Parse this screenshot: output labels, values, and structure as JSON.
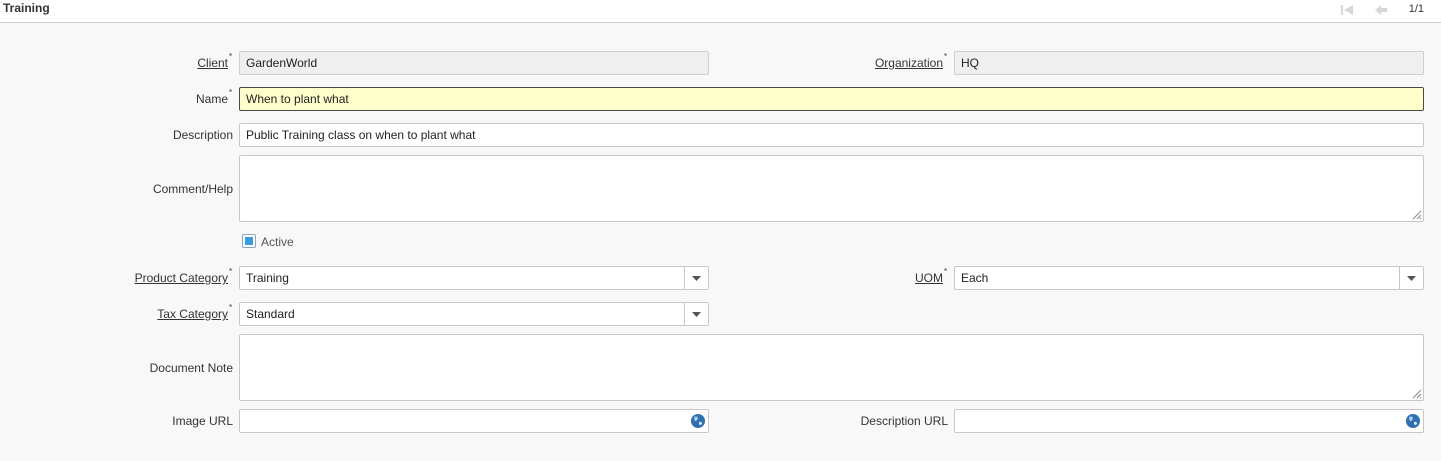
{
  "window": {
    "title": "Training",
    "pager": "1/1"
  },
  "form": {
    "client": {
      "label": "Client",
      "value": "GardenWorld",
      "required_mark": "*"
    },
    "organization": {
      "label": "Organization",
      "value": "HQ",
      "required_mark": "*"
    },
    "name": {
      "label": "Name",
      "value": "When to plant what",
      "required_mark": "*"
    },
    "description": {
      "label": "Description",
      "value": "Public Training class on when to plant what"
    },
    "comment_help": {
      "label": "Comment/Help",
      "value": ""
    },
    "active": {
      "label": "Active",
      "checked": true
    },
    "product_category": {
      "label": "Product Category",
      "value": "Training",
      "required_mark": "*"
    },
    "uom": {
      "label": "UOM",
      "value": "Each",
      "required_mark": "*"
    },
    "tax_category": {
      "label": "Tax Category",
      "value": "Standard",
      "required_mark": "*"
    },
    "document_note": {
      "label": "Document Note",
      "value": ""
    },
    "image_url": {
      "label": "Image URL",
      "value": ""
    },
    "description_url": {
      "label": "Description URL",
      "value": ""
    }
  },
  "colors": {
    "focus_bg": "#ffffcc",
    "readonly_bg": "#efefef",
    "check_fill": "#3a9be0"
  }
}
